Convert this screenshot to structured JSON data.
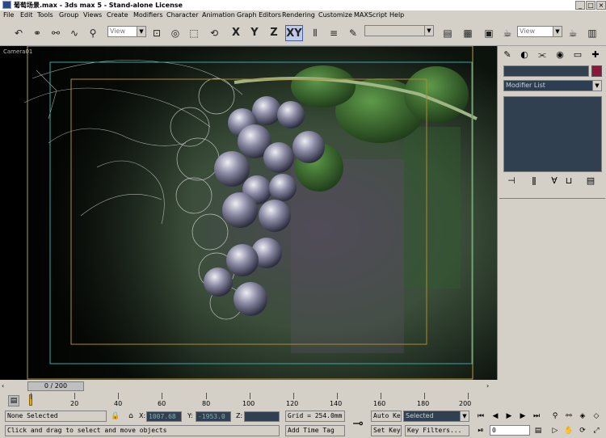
{
  "window": {
    "title": "葡萄场景.max - 3ds max 5 - Stand-alone License",
    "min": "_",
    "max": "□",
    "close": "×"
  },
  "menu": [
    "File",
    "Edit",
    "Tools",
    "Group",
    "Views",
    "Create",
    "Modifiers",
    "Character",
    "Animation",
    "Graph Editors",
    "Rendering",
    "Customize",
    "MAXScript",
    "Help"
  ],
  "toolbar": {
    "ref_coord": "View",
    "axis_x": "X",
    "axis_y": "Y",
    "axis_z": "Z",
    "axis_xy": "XY",
    "named_selection": "",
    "render_type": "View"
  },
  "viewport": {
    "label": "Camera01"
  },
  "command_panel": {
    "object_name": "",
    "name_color": "#8b1a3a",
    "modifier_list": "Modifier List"
  },
  "time": {
    "slider": "0 / 200",
    "ticks": [
      "20",
      "40",
      "60",
      "80",
      "100",
      "120",
      "140",
      "160",
      "180",
      "200"
    ]
  },
  "status": {
    "selection": "None Selected",
    "prompt": "Click and drag to select and move objects",
    "x_label": "X:",
    "x_value": "1007.68",
    "y_label": "Y:",
    "y_value": "-1953.0",
    "z_label": "Z:",
    "z_value": "",
    "grid": "Grid = 254.0mm",
    "add_time_tag": "Add Time Tag",
    "auto_key": "Auto Key",
    "set_key": "Set Key",
    "key_mode": "Selected",
    "key_filters": "Key Filters...",
    "frame": "0"
  }
}
